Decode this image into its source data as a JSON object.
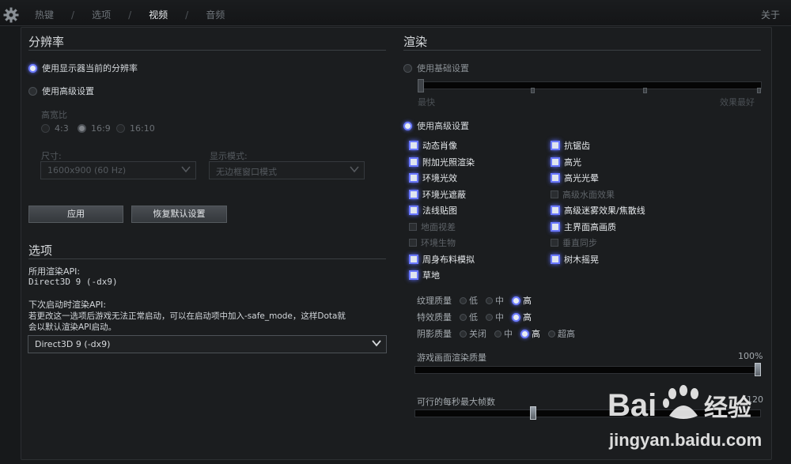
{
  "tabs": [
    {
      "label": "热键",
      "active": false
    },
    {
      "label": "选项",
      "active": false
    },
    {
      "label": "视频",
      "active": true
    },
    {
      "label": "音频",
      "active": false
    }
  ],
  "separator": "/",
  "about": "关于",
  "resolution": {
    "title": "分辨率",
    "use_current": "使用显示器当前的分辨率",
    "use_advanced": "使用高级设置",
    "aspect_label": "高宽比",
    "aspect_options": [
      "4:3",
      "16:9",
      "16:10"
    ],
    "aspect_selected": "16:9",
    "size_label": "尺寸:",
    "size_value": "1600x900 (60 Hz)",
    "display_mode_label": "显示模式:",
    "display_mode_value": "无边框窗口模式",
    "apply_button": "应用",
    "restore_button": "恢复默认设置"
  },
  "options": {
    "title": "选项",
    "api_label": "所用渲染API:",
    "api_value": "Direct3D 9 (-dx9)",
    "next_api_label": "下次启动时渲染API:",
    "note_line1": "若更改这一选项后游戏无法正常启动，可以在启动项中加入-safe_mode，这样Dota就",
    "note_line2": "会以默认渲染API启动。",
    "next_api_value": "Direct3D 9 (-dx9)"
  },
  "render": {
    "title": "渲染",
    "use_basic": "使用基础设置",
    "slider_min_label": "最快",
    "slider_max_label": "效果最好",
    "use_advanced": "使用高级设置",
    "checkboxes_left": [
      {
        "label": "动态肖像",
        "checked": true
      },
      {
        "label": "附加光照渲染",
        "checked": true
      },
      {
        "label": "环境光效",
        "checked": true
      },
      {
        "label": "环境光遮蔽",
        "checked": true
      },
      {
        "label": "法线贴图",
        "checked": true
      },
      {
        "label": "地面视差",
        "checked": false
      },
      {
        "label": "环境生物",
        "checked": false
      },
      {
        "label": "周身布料模拟",
        "checked": true
      },
      {
        "label": "草地",
        "checked": true
      }
    ],
    "checkboxes_right": [
      {
        "label": "抗锯齿",
        "checked": true
      },
      {
        "label": "高光",
        "checked": true
      },
      {
        "label": "高光光晕",
        "checked": true
      },
      {
        "label": "高级水面效果",
        "checked": false
      },
      {
        "label": "高级迷雾效果/焦散线",
        "checked": true
      },
      {
        "label": "主界面高画质",
        "checked": true
      },
      {
        "label": "垂直同步",
        "checked": false
      },
      {
        "label": "树木摇晃",
        "checked": true
      }
    ],
    "texture_quality": {
      "label": "纹理质量",
      "options": [
        "低",
        "中",
        "高"
      ],
      "selected": "高"
    },
    "effects_quality": {
      "label": "特效质量",
      "options": [
        "低",
        "中",
        "高"
      ],
      "selected": "高"
    },
    "shadow_quality": {
      "label": "阴影质量",
      "options": [
        "关闭",
        "中",
        "高",
        "超高"
      ],
      "selected": "高"
    },
    "render_quality_label": "游戏画面渲染质量",
    "render_quality_value": "100%",
    "render_quality_fraction": 1.0,
    "fps_label": "可行的每秒最大帧数",
    "fps_value": "120",
    "fps_fraction": 0.34
  },
  "watermark": {
    "brand": "Bai du 经验",
    "url": "jingyan.baidu.com"
  }
}
